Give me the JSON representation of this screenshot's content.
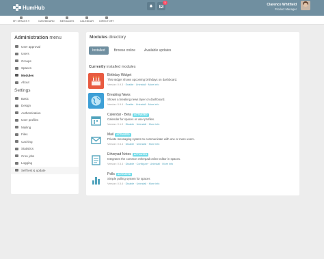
{
  "brand": {
    "name": "HumHub"
  },
  "topbar": {
    "notifications_count": "1",
    "user_name": "Clarence Whitfield",
    "user_title": "Product Manager"
  },
  "nav": [
    {
      "label": "MY SPACES ▾",
      "icon": "grid-icon"
    },
    {
      "label": "DASHBOARD",
      "icon": "tachometer-icon"
    },
    {
      "label": "MESSAGES",
      "icon": "envelope-icon"
    },
    {
      "label": "CALENDAR",
      "icon": "calendar-icon"
    },
    {
      "label": "DIRECTORY",
      "icon": "book-icon"
    }
  ],
  "sidebar": {
    "heading_bold": "Administration",
    "heading_rest": " menu",
    "admin_items": [
      {
        "label": "User approval",
        "icon": "user-check-icon"
      },
      {
        "label": "Users",
        "icon": "user-icon"
      },
      {
        "label": "Groups",
        "icon": "users-icon"
      },
      {
        "label": "Spaces",
        "icon": "inbox-icon"
      },
      {
        "label": "Modules",
        "icon": "rocket-icon"
      },
      {
        "label": "About",
        "icon": "info-icon"
      }
    ],
    "settings_heading": "Settings",
    "settings_items": [
      {
        "label": "Basic",
        "icon": "wrench-icon"
      },
      {
        "label": "Design",
        "icon": "magic-icon"
      },
      {
        "label": "Authentication",
        "icon": "lock-icon"
      },
      {
        "label": "User profiles",
        "icon": "user-icon"
      },
      {
        "label": "Mailing",
        "icon": "envelope-icon"
      },
      {
        "label": "Files",
        "icon": "file-icon"
      },
      {
        "label": "Caching",
        "icon": "dashboard-icon"
      },
      {
        "label": "Statistics",
        "icon": "bar-chart-icon"
      },
      {
        "label": "Cron jobs",
        "icon": "clock-icon"
      },
      {
        "label": "Logging",
        "icon": "list-icon"
      },
      {
        "label": "Self test & update",
        "icon": "check-icon"
      }
    ]
  },
  "main": {
    "title_bold": "Modules",
    "title_rest": " directory",
    "tabs": [
      {
        "label": "Installed"
      },
      {
        "label": "Browse online"
      },
      {
        "label": "Available updates"
      }
    ],
    "section_bold": "Currently",
    "section_rest": " installed modules",
    "link_sep": " · ",
    "modules": [
      {
        "name": "Birthday Widget",
        "badge": "",
        "desc": "This widget shows upcoming birthdays on dashboard.",
        "version": "Version: 0.9.3 · ",
        "links": [
          "Enable",
          "Uninstall",
          "More info"
        ]
      },
      {
        "name": "Breaking News",
        "badge": "",
        "desc": "Shows a breaking news layer on dashboard.",
        "version": "Version: 0.9.4 · ",
        "links": [
          "Enable",
          "Uninstall",
          "More info"
        ]
      },
      {
        "name": "Calendar - Beta",
        "badge": "ACTIVATED",
        "desc": "Calendar for spaces or user profiles.",
        "version": "Version: 0.1.0 · ",
        "links": [
          "Disable",
          "Uninstall",
          "More info"
        ]
      },
      {
        "name": "Mail",
        "badge": "ACTIVATED",
        "desc": "Private messaging system to communicate with one or more users.",
        "version": "Version: 0.5.4 · ",
        "links": [
          "Disable",
          "Uninstall",
          "More info"
        ]
      },
      {
        "name": "Etherpad Notes",
        "badge": "ACTIVATED",
        "desc": "Integrates the common etherpad online editor in spaces.",
        "version": "Version: 0.5.4 · ",
        "links": [
          "Disable",
          "Configure",
          "Uninstall",
          "More info"
        ]
      },
      {
        "name": "Polls",
        "badge": "ACTIVATED",
        "desc": "Simple polling system for spaces",
        "version": "Version: 0.5.6 · ",
        "links": [
          "Disable",
          "Uninstall",
          "More info"
        ]
      }
    ]
  },
  "colors": {
    "header": "#708fa0",
    "accent": "#52a4bd",
    "activated_badge": "#6fdbe8",
    "notification": "#fc4a64"
  }
}
